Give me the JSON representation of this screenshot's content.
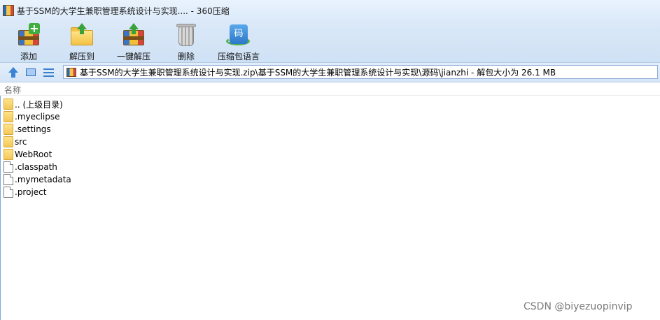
{
  "window": {
    "title": "基于SSM的大学生兼职管理系统设计与实现.... - 360压缩"
  },
  "toolbar": {
    "buttons": [
      {
        "label": "添加",
        "icon": "add-archive-icon"
      },
      {
        "label": "解压到",
        "icon": "extract-to-icon"
      },
      {
        "label": "一键解压",
        "icon": "one-click-extract-icon"
      },
      {
        "label": "删除",
        "icon": "delete-bin-icon"
      },
      {
        "label": "压缩包语言",
        "icon": "archive-language-icon",
        "glyph": "码"
      }
    ]
  },
  "address": {
    "path": "基于SSM的大学生兼职管理系统设计与实现.zip\\基于SSM的大学生兼职管理系统设计与实现\\源码\\jianzhi - 解包大小为 26.1 MB"
  },
  "list": {
    "column_name": "名称",
    "items": [
      {
        "name": ".. (上级目录)",
        "type": "folder"
      },
      {
        "name": ".myeclipse",
        "type": "folder"
      },
      {
        "name": ".settings",
        "type": "folder"
      },
      {
        "name": "src",
        "type": "folder"
      },
      {
        "name": "WebRoot",
        "type": "folder"
      },
      {
        "name": ".classpath",
        "type": "file"
      },
      {
        "name": ".mymetadata",
        "type": "file"
      },
      {
        "name": ".project",
        "type": "file"
      }
    ]
  },
  "watermark": "CSDN @biyezuopinvip",
  "colors": {
    "toolbar_bg": "#d4e4f6",
    "folder": "#f3c757",
    "accent": "#3a84d6"
  }
}
